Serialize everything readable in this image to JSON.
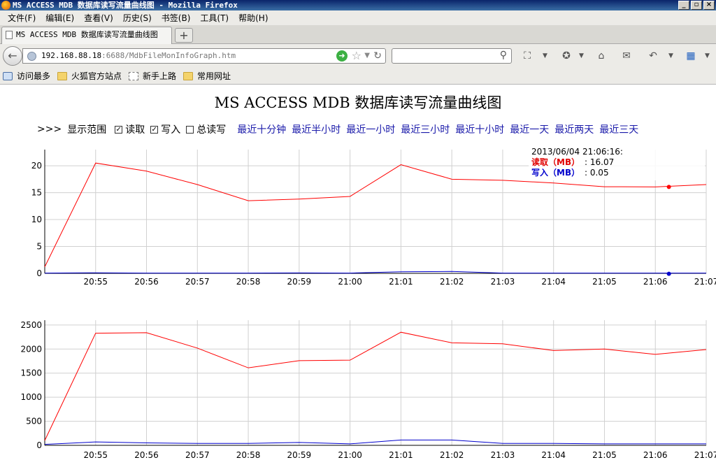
{
  "window": {
    "title": "MS ACCESS MDB 数据库读写流量曲线图 - Mozilla Firefox",
    "buttons": [
      "_",
      "▫",
      "×"
    ]
  },
  "menu": [
    "文件(F)",
    "编辑(E)",
    "查看(V)",
    "历史(S)",
    "书签(B)",
    "工具(T)",
    "帮助(H)"
  ],
  "tab": {
    "label": "MS ACCESS MDB 数据库读写流量曲线图",
    "new_tab": "+"
  },
  "nav": {
    "url_host": "192.168.88.18",
    "url_rest": ":6688/MdbFileMonInfoGraph.htm",
    "search_placeholder": ""
  },
  "bookmarks": [
    {
      "label": "访问最多",
      "icon": "most-visited-icon"
    },
    {
      "label": "火狐官方站点",
      "icon": "folder-icon"
    },
    {
      "label": "新手上路",
      "icon": "page-icon"
    },
    {
      "label": "常用网址",
      "icon": "folder-icon"
    }
  ],
  "page": {
    "title": "MS ACCESS MDB 数据库读写流量曲线图",
    "controls": {
      "prefix": ">>>",
      "label": "显示范围",
      "checkboxes": [
        {
          "label": "读取",
          "checked": true
        },
        {
          "label": "写入",
          "checked": true
        },
        {
          "label": "总读写",
          "checked": false
        }
      ],
      "ranges": [
        "最近十分钟",
        "最近半小时",
        "最近一小时",
        "最近三小时",
        "最近十小时",
        "最近一天",
        "最近两天",
        "最近三天"
      ]
    },
    "tooltip": {
      "date": "2013/06/04 21:06:16:",
      "read_label": "读取（MB）",
      "read_value": ": 16.07",
      "write_label": "写入（MB）",
      "write_value": ": 0.05"
    }
  },
  "colors": {
    "read": "#ff0000",
    "write": "#0000cc",
    "grid": "#d0d0d0"
  },
  "chart_data": [
    {
      "type": "line",
      "x_ticks": [
        "20:55",
        "20:56",
        "20:57",
        "20:58",
        "20:59",
        "21:00",
        "21:01",
        "21:02",
        "21:03",
        "21:04",
        "21:05",
        "21:06",
        "21:07"
      ],
      "xlim": [
        "20:54",
        "21:07"
      ],
      "y_ticks": [
        0,
        5,
        10,
        15,
        20
      ],
      "ylim": [
        0,
        23
      ],
      "grid": true,
      "series": [
        {
          "name": "读取（MB）",
          "color": "#ff0000",
          "x": [
            "20:54",
            "20:55",
            "20:56",
            "20:57",
            "20:58",
            "20:59",
            "21:00",
            "21:01",
            "21:02",
            "21:03",
            "21:04",
            "21:05",
            "21:06",
            "21:07"
          ],
          "values": [
            1.2,
            20.5,
            19.0,
            16.5,
            13.5,
            13.8,
            14.3,
            20.2,
            17.5,
            17.3,
            16.8,
            16.1,
            16.07,
            16.5
          ]
        },
        {
          "name": "写入（MB）",
          "color": "#0000cc",
          "x": [
            "20:54",
            "20:55",
            "20:56",
            "20:57",
            "20:58",
            "20:59",
            "21:00",
            "21:01",
            "21:02",
            "21:03",
            "21:04",
            "21:05",
            "21:06",
            "21:07"
          ],
          "values": [
            0.05,
            0.1,
            0.05,
            0.05,
            0.05,
            0.08,
            0.05,
            0.3,
            0.35,
            0.05,
            0.05,
            0.05,
            0.05,
            0.05
          ]
        }
      ],
      "highlight": {
        "x": "21:06",
        "read": 16.07,
        "write": 0.05
      }
    },
    {
      "type": "line",
      "x_ticks": [
        "20:55",
        "20:56",
        "20:57",
        "20:58",
        "20:59",
        "21:00",
        "21:01",
        "21:02",
        "21:03",
        "21:04",
        "21:05",
        "21:06",
        "21:07"
      ],
      "xlim": [
        "20:54",
        "21:07"
      ],
      "y_ticks": [
        0,
        500,
        1000,
        1500,
        2000,
        2500
      ],
      "ylim": [
        0,
        2600
      ],
      "grid": true,
      "series": [
        {
          "color": "#ff0000",
          "x": [
            "20:54",
            "20:55",
            "20:56",
            "20:57",
            "20:58",
            "20:59",
            "21:00",
            "21:01",
            "21:02",
            "21:03",
            "21:04",
            "21:05",
            "21:06",
            "21:07"
          ],
          "values": [
            100,
            2330,
            2340,
            2020,
            1610,
            1760,
            1770,
            2350,
            2130,
            2110,
            1970,
            2000,
            1890,
            1990
          ]
        },
        {
          "color": "#0000cc",
          "x": [
            "20:54",
            "20:55",
            "20:56",
            "20:57",
            "20:58",
            "20:59",
            "21:00",
            "21:01",
            "21:02",
            "21:03",
            "21:04",
            "21:05",
            "21:06",
            "21:07"
          ],
          "values": [
            20,
            70,
            50,
            40,
            40,
            60,
            30,
            110,
            110,
            40,
            40,
            30,
            30,
            30
          ]
        }
      ]
    }
  ]
}
